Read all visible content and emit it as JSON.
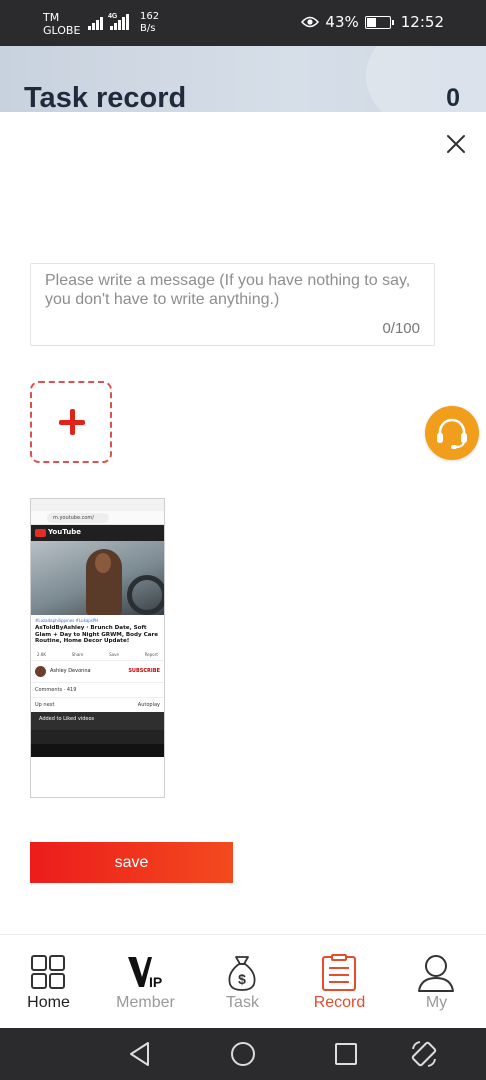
{
  "status_bar": {
    "carrier_line1": "TM",
    "carrier_line2": "GLOBE",
    "network_tag": "4G",
    "speed_value": "162",
    "speed_unit": "B/s",
    "battery": "43%",
    "battery_level": 0.43,
    "time": "12:52"
  },
  "header": {
    "title": "Task record",
    "count": "0"
  },
  "message": {
    "placeholder": "Please write a message (If you have nothing to say, you don't have to write anything.)",
    "value": "",
    "char_count": "0/100"
  },
  "screenshot": {
    "url": "m.youtube.com/",
    "brand": "YouTube",
    "tags": "#Lazadaphilippines #LukapsPH",
    "video_title": "AsToldByAshley · Brunch Date, Soft Glam + Day to Night GRWM, Body Care Routine, Home Decor Update!",
    "views": "",
    "action_likes": "2.8K",
    "action_share": "Share",
    "action_save": "Save",
    "action_report": "Report",
    "channel": "Ashley Devonna",
    "subscribe": "SUBSCRIBE",
    "comments": "Comments · 419",
    "up_next": "Up next",
    "autoplay": "Autoplay",
    "toast": "Added to Liked videos"
  },
  "save_button": "save",
  "tabs": [
    {
      "label": "Home",
      "icon": "home-grid-icon",
      "state": "active-dark"
    },
    {
      "label": "Member",
      "icon": "vip-icon",
      "state": "inactive"
    },
    {
      "label": "Task",
      "icon": "money-bag-icon",
      "state": "inactive"
    },
    {
      "label": "Record",
      "icon": "clipboard-icon",
      "state": "active-red"
    },
    {
      "label": "My",
      "icon": "user-icon",
      "state": "inactive"
    }
  ],
  "colors": {
    "accent_red": "#e84a2a",
    "support_orange": "#f19e1c",
    "save_gradient_start": "#ec1c1c",
    "save_gradient_end": "#f34a1e"
  }
}
